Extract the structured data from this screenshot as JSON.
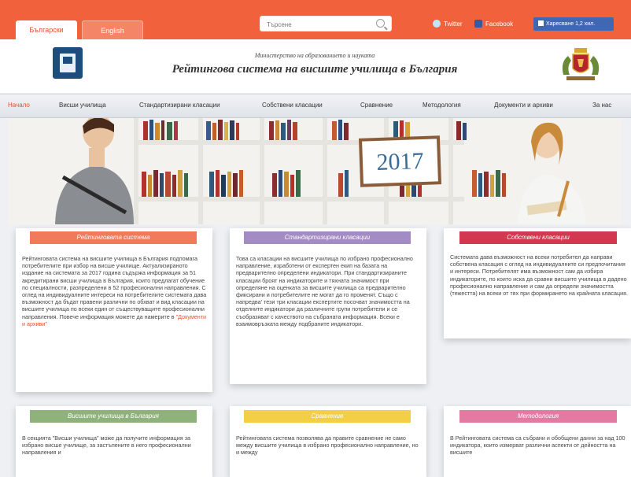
{
  "topbar": {
    "lang_bg": "Български",
    "lang_en": "English",
    "search_placeholder": "Търсене",
    "twitter": "Twitter",
    "facebook": "Facebook",
    "fb_like": "Харесване 1,2 хил."
  },
  "header": {
    "ministry": "Министерство на образованието и науката",
    "title": "Рейтингова система на висшите училища в България"
  },
  "nav": {
    "items": [
      "Начало",
      "Висши училища",
      "Стандартизирани класации",
      "Собствени класации",
      "Сравнение",
      "Методология",
      "Документи и архиви",
      "За нас"
    ]
  },
  "banner": {
    "year": "2017"
  },
  "cards": [
    {
      "title": "Рейтинговата система",
      "body": "Рейтинговата система на висшите училища в България подпомага потребителите при избор на висше училище. Актуализираното издание на системата за 2017 година съдържа информация за 51 акредитирани висши училища в България, които предлагат обучение по специалности, разпределени в 52 професионални направления. С оглед на индивидуалните интереси на потребителите системата дава възможност да бъдат правени различни по обхват и вид класации на висшите училища по всеки един от съществуващите професионални направления. Повече информация можете да намерите в",
      "more": "\"Документи и архиви\""
    },
    {
      "title": "Стандартизирани класации",
      "body": "Това са класации на висшите училища по избрано професионално направление, изработени от експертен екип на базата на предварително определени индикатори. При стандартизираните класации броят на индикаторите и тяхната значимост при определяне на оценката за висшите училища са предварително фиксирани и потребителите не могат да го променят. Също с напредва' тези три класации експертите посочват значимостта на отделните индикатори да различните групи потребители и се съобразяват с качеството на събраната информация. Всеки е взаимовръзката между подбраните индикатори."
    },
    {
      "title": "Собствени класации",
      "body": "Системата дава възможност на всеки потребител да направи собствена класация с оглед на индивидуалните си предпочитания и интереси. Потребителят има възможност сам да избира индикаторите, по които иска да сравни висшите училища в дадено професионално направление и сам да определи значимостта (тежестта) на всеки от тях при формирането на крайната класация."
    },
    {
      "title": "Висшите училища в България",
      "body": "В секцията \"Висши училища\" може да получите информация за избрано висше училище, за застъпените в него професионални направления и"
    },
    {
      "title": "Сравнение",
      "body": "Рейтинговата система позволява да правите сравнение не само между висшите училища в избрано професионално направление, но и между"
    },
    {
      "title": "Методология",
      "body": "В Рейтинговата система са събрани и обобщени данни за над 100 индикатора, които измерват различни аспекти от дейността на висшите"
    }
  ],
  "colors": {
    "topbar": "#f0613c",
    "card1": "#f27a5c",
    "card2": "#a38bc4",
    "card3": "#d2384f",
    "card4": "#8fb27c",
    "card5": "#f2cf45",
    "card6": "#e27aa2"
  }
}
